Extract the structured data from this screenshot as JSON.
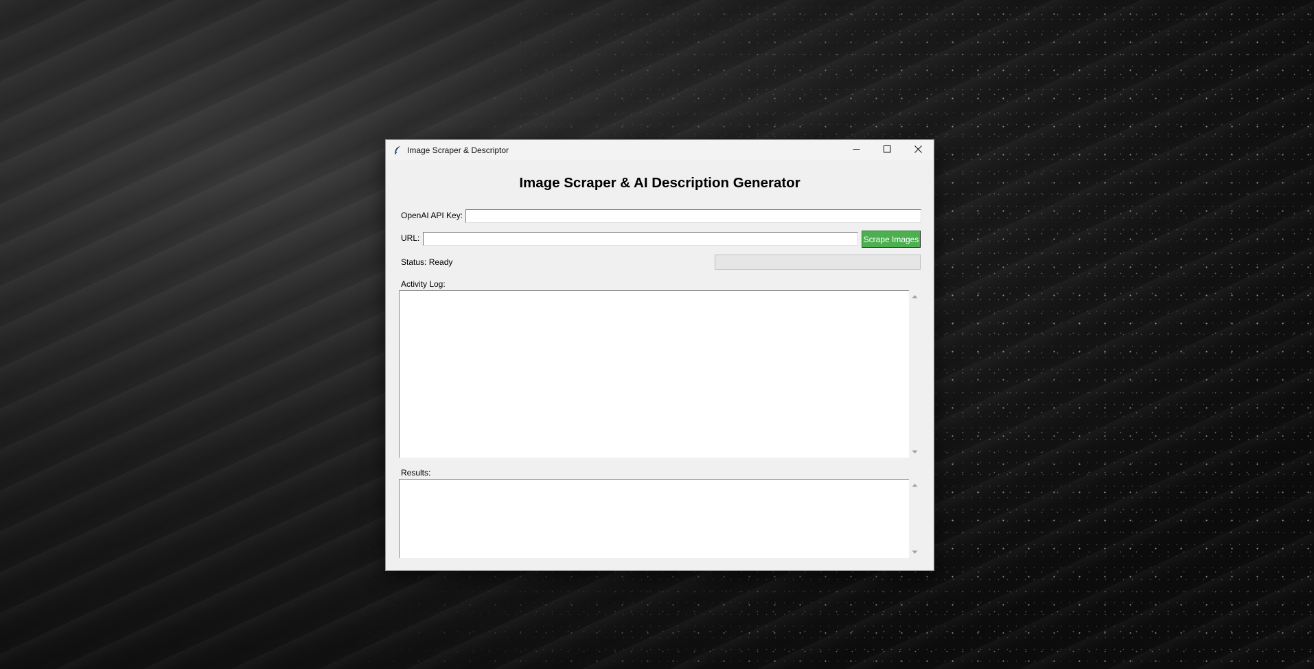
{
  "window": {
    "title": "Image Scraper & Descriptor",
    "icon": "feather-icon",
    "controls": [
      "minimize-icon",
      "maximize-icon",
      "close-icon"
    ]
  },
  "main": {
    "heading": "Image Scraper & AI Description Generator",
    "api_key": {
      "label": "OpenAI API Key:",
      "value": ""
    },
    "url": {
      "label": "URL:",
      "value": ""
    },
    "scrape_button": {
      "label": "Scrape Images",
      "color": "#4caf50"
    },
    "status": {
      "text": "Status: Ready"
    },
    "progress": {
      "value": 0
    },
    "activity_log": {
      "label": "Activity Log:",
      "content": ""
    },
    "results": {
      "label": "Results:",
      "content": ""
    }
  }
}
